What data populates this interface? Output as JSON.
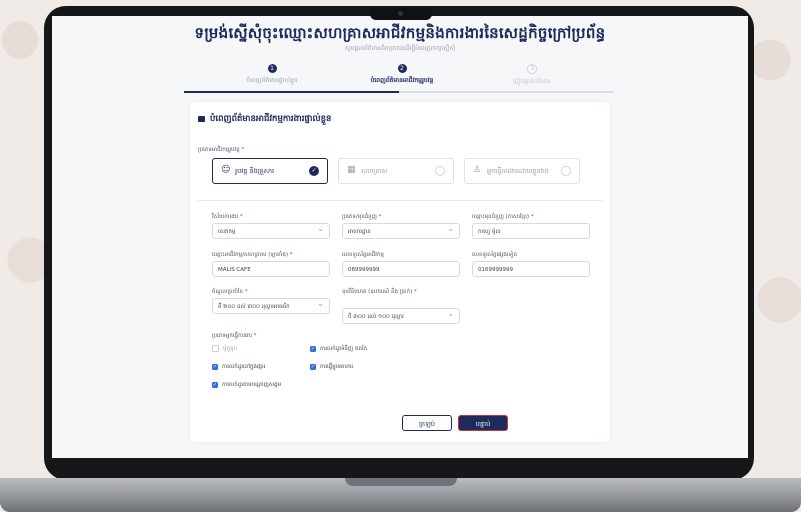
{
  "header": {
    "title": "ទម្រង់ស្នើសុំចុះឈ្មោះសហគ្រាសអាជីវកម្មនិងការងារនៃសេដ្ឋកិច្ចក្រៅប្រព័ន្ធ",
    "subtitle": "សូមផ្ដល់ព័ត៌មានពិតប្រាកដដើម្បីបំពេញពាក្យស្នើសុំ"
  },
  "steps": [
    {
      "number": "1",
      "label": "បំពេញព័ត៌មានផ្ទាល់ខ្លួន",
      "state": "done"
    },
    {
      "number": "2",
      "label": "បំពេញព័ត៌មានអាជីវកម្មរូបវន្ត",
      "state": "active"
    },
    {
      "number": "3",
      "label": "ផ្ទៀងផ្ទាត់ព័ត៌មាន",
      "state": "todo"
    }
  ],
  "form": {
    "section_title": "បំពេញព័ត៌មានអាជីវកម្មការងារផ្ទាល់ខ្លួន",
    "type_label": "ប្រភេទអាជីវកម្មរូបវន្ត",
    "types": [
      {
        "label": "រូបវន្ត និងគ្រួសារ",
        "icon": "person-icon",
        "selected": true
      },
      {
        "label": "សហគ្រាស",
        "icon": "building-icon",
        "selected": false
      },
      {
        "label": "អ្នកធ្វើការងារដោយខ្លួនឯង",
        "icon": "worker-icon",
        "selected": false
      }
    ],
    "fields": {
      "sector": {
        "label": "វិស័យការងារ",
        "value": "សេវាកម្ម"
      },
      "activity": {
        "label": "ប្រភេទ/មុខជំនួញ",
        "value": "អាហារដ្ឋាន"
      },
      "business_name_kh": {
        "label": "ឈ្មោះមុខជំនួញ (ភាសាខ្មែរ)",
        "value": "កាហ្វេ ម៉ូល"
      },
      "business_name_en": {
        "label": "ឈ្មោះអាជីវកម្ម/សហគ្រាស (ឡាតាំង)",
        "value": "MALIS CAFE"
      },
      "phone": {
        "label": "លេខទូរស័ព្ទអាជីវកម្ម",
        "value": "089999999"
      },
      "phone2": {
        "label": "លេខទូរស័ព្ទផ្សេងទៀត",
        "value": "0169999999"
      },
      "revenue": {
        "label": "ចំណូលប្រចាំខែ",
        "value": "ពី ២០០ ដល់ ៣០០ ដុល្លារអាមេរិក"
      },
      "capital": {
        "label": "ទុនវិនិយោគ (ឧបករណ៍ និង ប្រាក់)",
        "value": "ពី ៣០០ ដល់ ១០០ ដុល្លារ"
      }
    },
    "checks_label": "ប្រភេទអ្នកធ្វើការងារ",
    "checks": [
      {
        "label": "ម៉ូតូឌុប",
        "checked": false
      },
      {
        "label": "ការលក់ដូរទំនិញ ចល័ត",
        "checked": true
      },
      {
        "label": "ការលក់ដូរនៅក្នុងផ្សារ",
        "checked": true
      },
      {
        "label": "ការធ្វើម្ហូបអាហារ",
        "checked": true
      },
      {
        "label": "ការលក់ដូរតាមបណ្ដាញសង្គម",
        "checked": true
      }
    ],
    "buttons": {
      "back": "ត្រឡប់",
      "next": "បន្ទាប់"
    }
  },
  "colors": {
    "primary": "#1f2a5c",
    "checkbox": "#2f6fd6",
    "accent": "#c0392b"
  }
}
